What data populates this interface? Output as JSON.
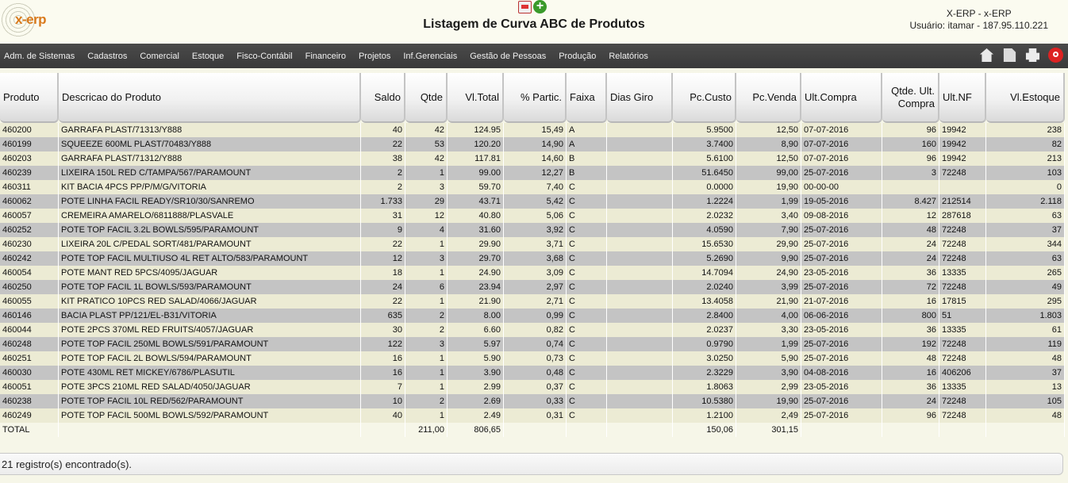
{
  "header": {
    "logo_text": "x-erp",
    "title": "Listagem de Curva ABC de Produtos",
    "system": "X-ERP - x-ERP",
    "user": "Usuário: itamar - 187.95.110.221"
  },
  "nav": {
    "items": [
      "Adm. de Sistemas",
      "Cadastros",
      "Comercial",
      "Estoque",
      "Fisco-Contábil",
      "Financeiro",
      "Projetos",
      "Inf.Gerenciais",
      "Gestão de Pessoas",
      "Produção",
      "Relatórios"
    ],
    "icons": [
      "home-icon",
      "export-icon",
      "print-icon",
      "power-icon"
    ]
  },
  "columns": [
    {
      "label": "Produto"
    },
    {
      "label": "Descricao do Produto"
    },
    {
      "label": "Saldo"
    },
    {
      "label": "Qtde"
    },
    {
      "label": "Vl.Total"
    },
    {
      "label": "% Partic."
    },
    {
      "label": "Faixa"
    },
    {
      "label": "Dias Giro"
    },
    {
      "label": "Pc.Custo"
    },
    {
      "label": "Pc.Venda"
    },
    {
      "label": "Ult.Compra"
    },
    {
      "label": "Qtde. Ult. Compra"
    },
    {
      "label": "Ult.NF"
    },
    {
      "label": "Vl.Estoque"
    }
  ],
  "rows": [
    [
      "460200",
      "GARRAFA PLAST/71313/Y888",
      "40",
      "42",
      "124.95",
      "15,49",
      "A",
      "",
      "5.9500",
      "12,50",
      "07-07-2016",
      "96",
      "19942",
      "238"
    ],
    [
      "460199",
      "SQUEEZE 600ML PLAST/70483/Y888",
      "22",
      "53",
      "120.20",
      "14,90",
      "A",
      "",
      "3.7400",
      "8,90",
      "07-07-2016",
      "160",
      "19942",
      "82"
    ],
    [
      "460203",
      "GARRAFA PLAST/71312/Y888",
      "38",
      "42",
      "117.81",
      "14,60",
      "B",
      "",
      "5.6100",
      "12,50",
      "07-07-2016",
      "96",
      "19942",
      "213"
    ],
    [
      "460239",
      "LIXEIRA 150L RED C/TAMPA/567/PARAMOUNT",
      "2",
      "1",
      "99.00",
      "12,27",
      "B",
      "",
      "51.6450",
      "99,00",
      "25-07-2016",
      "3",
      "72248",
      "103"
    ],
    [
      "460311",
      "KIT BACIA 4PCS PP/P/M/G/VITORIA",
      "2",
      "3",
      "59.70",
      "7,40",
      "C",
      "",
      "0.0000",
      "19,90",
      "00-00-00",
      "",
      "",
      "0"
    ],
    [
      "460062",
      "POTE LINHA FACIL READY/SR10/30/SANREMO",
      "1.733",
      "29",
      "43.71",
      "5,42",
      "C",
      "",
      "1.2224",
      "1,99",
      "19-05-2016",
      "8.427",
      "212514",
      "2.118"
    ],
    [
      "460057",
      "CREMEIRA AMARELO/6811888/PLASVALE",
      "31",
      "12",
      "40.80",
      "5,06",
      "C",
      "",
      "2.0232",
      "3,40",
      "09-08-2016",
      "12",
      "287618",
      "63"
    ],
    [
      "460252",
      "POTE TOP FACIL 3.2L BOWLS/595/PARAMOUNT",
      "9",
      "4",
      "31.60",
      "3,92",
      "C",
      "",
      "4.0590",
      "7,90",
      "25-07-2016",
      "48",
      "72248",
      "37"
    ],
    [
      "460230",
      "LIXEIRA 20L C/PEDAL SORT/481/PARAMOUNT",
      "22",
      "1",
      "29.90",
      "3,71",
      "C",
      "",
      "15.6530",
      "29,90",
      "25-07-2016",
      "24",
      "72248",
      "344"
    ],
    [
      "460242",
      "POTE TOP FACIL MULTIUSO 4L RET ALTO/583/PARAMOUNT",
      "12",
      "3",
      "29.70",
      "3,68",
      "C",
      "",
      "5.2690",
      "9,90",
      "25-07-2016",
      "24",
      "72248",
      "63"
    ],
    [
      "460054",
      "POTE MANT RED 5PCS/4095/JAGUAR",
      "18",
      "1",
      "24.90",
      "3,09",
      "C",
      "",
      "14.7094",
      "24,90",
      "23-05-2016",
      "36",
      "13335",
      "265"
    ],
    [
      "460250",
      "POTE TOP FACIL 1L BOWLS/593/PARAMOUNT",
      "24",
      "6",
      "23.94",
      "2,97",
      "C",
      "",
      "2.0240",
      "3,99",
      "25-07-2016",
      "72",
      "72248",
      "49"
    ],
    [
      "460055",
      "KIT PRATICO 10PCS RED SALAD/4066/JAGUAR",
      "22",
      "1",
      "21.90",
      "2,71",
      "C",
      "",
      "13.4058",
      "21,90",
      "21-07-2016",
      "16",
      "17815",
      "295"
    ],
    [
      "460146",
      "BACIA PLAST PP/121/EL-B31/VITORIA",
      "635",
      "2",
      "8.00",
      "0,99",
      "C",
      "",
      "2.8400",
      "4,00",
      "06-06-2016",
      "800",
      "51",
      "1.803"
    ],
    [
      "460044",
      "POTE 2PCS 370ML RED FRUITS/4057/JAGUAR",
      "30",
      "2",
      "6.60",
      "0,82",
      "C",
      "",
      "2.0237",
      "3,30",
      "23-05-2016",
      "36",
      "13335",
      "61"
    ],
    [
      "460248",
      "POTE TOP FACIL 250ML BOWLS/591/PARAMOUNT",
      "122",
      "3",
      "5.97",
      "0,74",
      "C",
      "",
      "0.9790",
      "1,99",
      "25-07-2016",
      "192",
      "72248",
      "119"
    ],
    [
      "460251",
      "POTE TOP FACIL 2L BOWLS/594/PARAMOUNT",
      "16",
      "1",
      "5.90",
      "0,73",
      "C",
      "",
      "3.0250",
      "5,90",
      "25-07-2016",
      "48",
      "72248",
      "48"
    ],
    [
      "460030",
      "POTE 430ML RET MICKEY/6786/PLASUTIL",
      "16",
      "1",
      "3.90",
      "0,48",
      "C",
      "",
      "2.3229",
      "3,90",
      "04-08-2016",
      "16",
      "406206",
      "37"
    ],
    [
      "460051",
      "POTE 3PCS 210ML RED SALAD/4050/JAGUAR",
      "7",
      "1",
      "2.99",
      "0,37",
      "C",
      "",
      "1.8063",
      "2,99",
      "23-05-2016",
      "36",
      "13335",
      "13"
    ],
    [
      "460238",
      "POTE TOP FACIL 10L RED/562/PARAMOUNT",
      "10",
      "2",
      "2.69",
      "0,33",
      "C",
      "",
      "10.5380",
      "19,90",
      "25-07-2016",
      "24",
      "72248",
      "105"
    ],
    [
      "460249",
      "POTE TOP FACIL 500ML BOWLS/592/PARAMOUNT",
      "40",
      "1",
      "2.49",
      "0,31",
      "C",
      "",
      "1.2100",
      "2,49",
      "25-07-2016",
      "96",
      "72248",
      "48"
    ]
  ],
  "totals": {
    "label": "TOTAL",
    "qtde": "211,00",
    "vl_total": "806,65",
    "pc_custo": "150,06",
    "pc_venda": "301,15"
  },
  "footer": {
    "records": "21 registro(s) encontrado(s)."
  }
}
